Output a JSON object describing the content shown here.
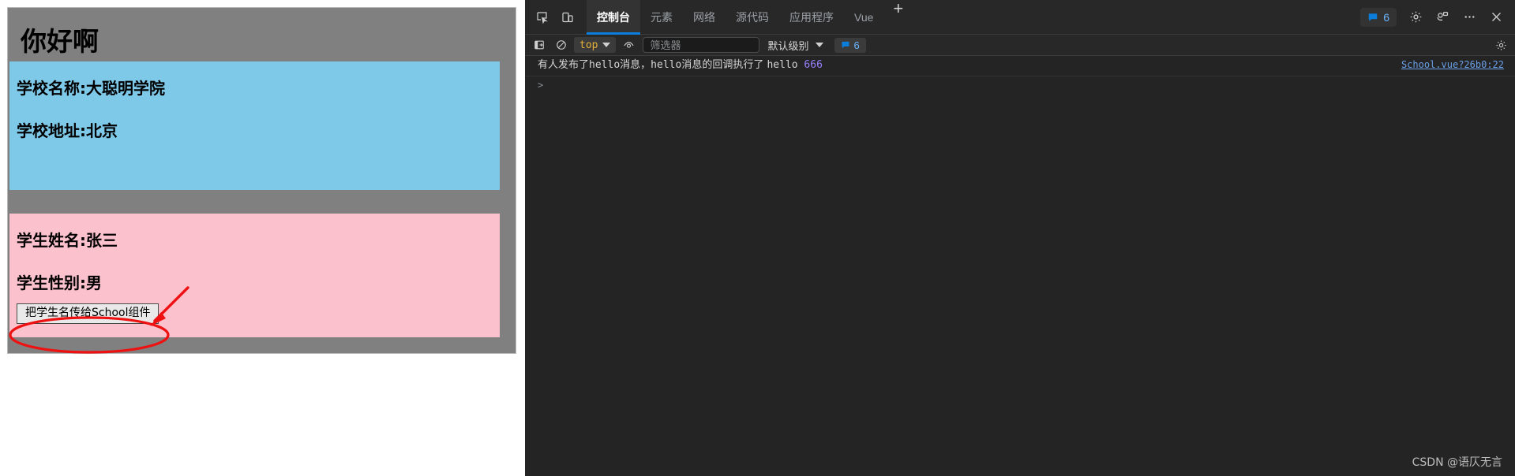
{
  "page": {
    "app_title": "你好啊",
    "school": {
      "name_line": "学校名称:大聪明学院",
      "address_line": "学校地址:北京"
    },
    "student": {
      "name_line": "学生姓名:张三",
      "gender_line": "学生性别:男",
      "button_label": "把学生名传给School组件"
    }
  },
  "devtools": {
    "icons": {
      "inspect": "inspect-element-icon",
      "device": "device-toolbar-icon",
      "settings": "gear-icon",
      "customize": "feedback-icon",
      "more": "more-options-icon",
      "close": "close-icon",
      "sidebar": "console-sidebar-icon",
      "clear": "clear-console-icon",
      "eye": "live-expression-icon"
    },
    "tabs": [
      {
        "label": "控制台",
        "active": true
      },
      {
        "label": "元素",
        "active": false
      },
      {
        "label": "网络",
        "active": false
      },
      {
        "label": "源代码",
        "active": false
      },
      {
        "label": "应用程序",
        "active": false
      },
      {
        "label": "Vue",
        "active": false
      }
    ],
    "new_tab_label": "+",
    "issues_count": "6",
    "filterbar": {
      "context_label": "top",
      "filter_placeholder": "筛选器",
      "filter_value": "",
      "level_label": "默认级别",
      "message_count": "6"
    },
    "console": {
      "message_prefix": "有人发布了",
      "message_code1": "hello",
      "message_mid": "消息，",
      "message_code2": "hello",
      "message_suffix": "消息的回调执行了 ",
      "message_arg": "hello",
      "message_number": "666",
      "source_link": "School.vue?26b0:22",
      "prompt": ">"
    },
    "watermark": "CSDN @语仄无言"
  },
  "colors": {
    "app_bg": "#808080",
    "school_bg": "#7ec8e8",
    "student_bg": "#fbc1cd",
    "accent": "#0b7ddb",
    "annotation": "#ee1111",
    "link": "#6a9fe8"
  }
}
